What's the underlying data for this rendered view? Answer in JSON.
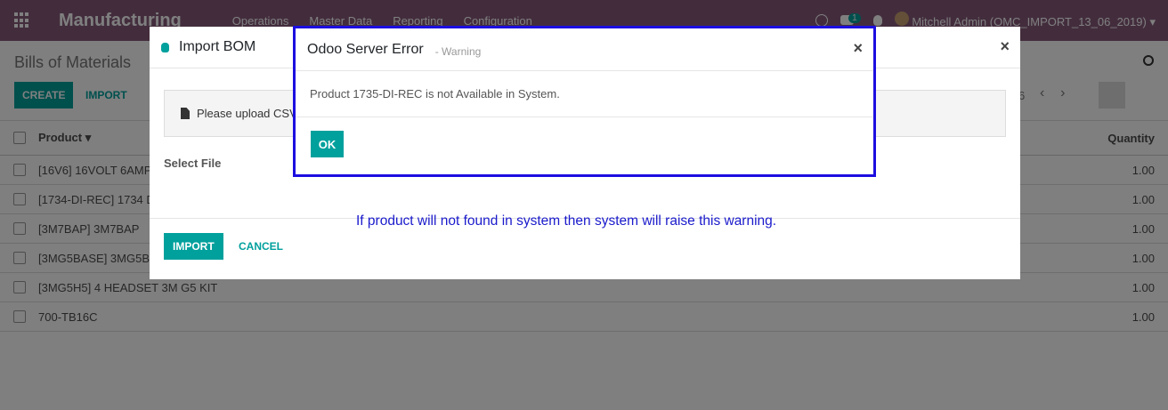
{
  "navbar": {
    "brand": "Manufacturing",
    "menu": [
      "Operations",
      "Master Data",
      "Reporting",
      "Configuration"
    ],
    "chat_badge": "1",
    "user": "Mitchell Admin (OMC_IMPORT_13_06_2019)",
    "user_caret": "▾"
  },
  "control_panel": {
    "title": "Bills of Materials",
    "create_label": "CREATE",
    "import_label": "IMPORT",
    "pager_tail": "6",
    "prev_arrow": "‹",
    "next_arrow": "›"
  },
  "list": {
    "header_product": "Product ▾",
    "header_quantity": "Quantity",
    "rows": [
      {
        "product": "[16V6] 16VOLT 6AMP",
        "qty": "1.00"
      },
      {
        "product": "[1734-DI-REC] 1734 D",
        "qty": "1.00"
      },
      {
        "product": "[3M7BAP] 3M7BAP",
        "qty": "1.00"
      },
      {
        "product": "[3MG5BASE] 3MG5BA",
        "qty": "1.00"
      },
      {
        "product": "[3MG5H5] 4 HEADSET 3M G5 KIT",
        "qty": "1.00"
      },
      {
        "product": "700-TB16C",
        "qty": "1.00"
      }
    ]
  },
  "import_modal": {
    "title": "Import BOM",
    "close": "×",
    "upload_text": "Please upload CSV",
    "select_file_label": "Select File",
    "import_button": "IMPORT",
    "cancel_button": "CANCEL"
  },
  "error_modal": {
    "title": "Odoo Server Error",
    "subtitle": "- Warning",
    "close": "×",
    "message": "Product 1735-DI-REC is not Available in System.",
    "ok_button": "OK"
  },
  "annotation": "If product will not found in system then system will raise this warning.",
  "colors": {
    "navbar": "#875a7b",
    "primary": "#00a09d",
    "annotation": "#1a1acc",
    "highlight_border": "#1c0ee0"
  }
}
